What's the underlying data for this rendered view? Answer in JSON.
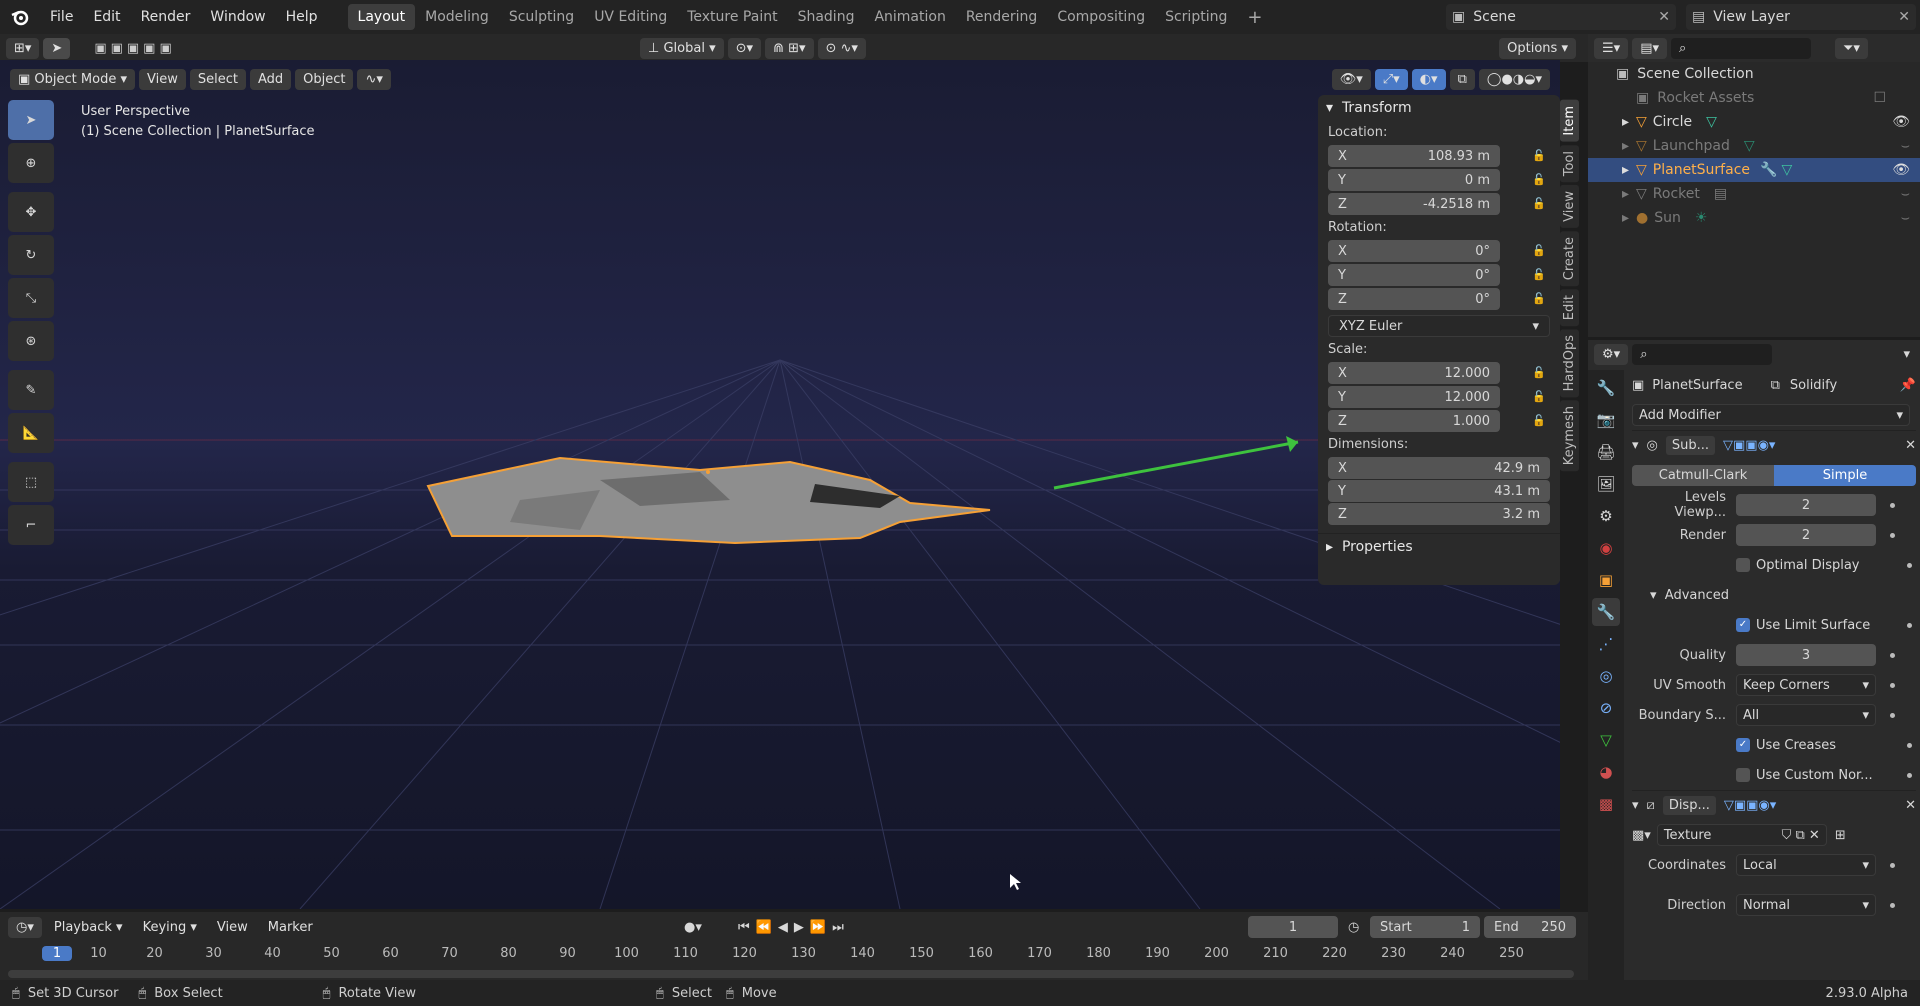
{
  "topbar": {
    "menus": [
      "File",
      "Edit",
      "Render",
      "Window",
      "Help"
    ],
    "workspaces": [
      "Layout",
      "Modeling",
      "Sculpting",
      "UV Editing",
      "Texture Paint",
      "Shading",
      "Animation",
      "Rendering",
      "Compositing",
      "Scripting"
    ],
    "scene": "Scene",
    "view_layer": "View Layer"
  },
  "toolhdr": {
    "orientation": "Global",
    "options": "Options"
  },
  "vphdr": {
    "mode": "Object Mode",
    "menus": [
      "View",
      "Select",
      "Add",
      "Object"
    ]
  },
  "viewport": {
    "perspective": "User Perspective",
    "collection": "(1) Scene Collection | PlanetSurface"
  },
  "npanel": {
    "title": "Transform",
    "location_label": "Location:",
    "loc": [
      {
        "axis": "X",
        "value": "108.93 m"
      },
      {
        "axis": "Y",
        "value": "0 m"
      },
      {
        "axis": "Z",
        "value": "-4.2518 m"
      }
    ],
    "rotation_label": "Rotation:",
    "rot": [
      {
        "axis": "X",
        "value": "0°"
      },
      {
        "axis": "Y",
        "value": "0°"
      },
      {
        "axis": "Z",
        "value": "0°"
      }
    ],
    "rot_mode": "XYZ Euler",
    "scale_label": "Scale:",
    "scale": [
      {
        "axis": "X",
        "value": "12.000"
      },
      {
        "axis": "Y",
        "value": "12.000"
      },
      {
        "axis": "Z",
        "value": "1.000"
      }
    ],
    "dimensions_label": "Dimensions:",
    "dim": [
      {
        "axis": "X",
        "value": "42.9 m"
      },
      {
        "axis": "Y",
        "value": "43.1 m"
      },
      {
        "axis": "Z",
        "value": "3.2 m"
      }
    ],
    "properties": "Properties"
  },
  "sidetabs": [
    "Item",
    "Tool",
    "View",
    "Create",
    "Edit",
    "HardOps",
    "Keymesh"
  ],
  "outliner": {
    "root": "Scene Collection",
    "items": [
      {
        "name": "Rocket Assets",
        "dim": true
      },
      {
        "name": "Circle",
        "dim": false
      },
      {
        "name": "Launchpad",
        "dim": true
      },
      {
        "name": "PlanetSurface",
        "dim": false,
        "selected": true
      },
      {
        "name": "Rocket",
        "dim": true
      },
      {
        "name": "Sun",
        "dim": true
      }
    ]
  },
  "props": {
    "object": "PlanetSurface",
    "modifier_breadcrumb": "Solidify",
    "add_modifier": "Add Modifier",
    "mod1": {
      "name": "Sub...",
      "type_a": "Catmull-Clark",
      "type_b": "Simple",
      "levels_label": "Levels Viewp...",
      "levels": "2",
      "render_label": "Render",
      "render": "2",
      "optimal": "Optimal Display",
      "advanced": "Advanced",
      "limit": "Use Limit Surface",
      "quality_label": "Quality",
      "quality": "3",
      "uvsmooth_label": "UV Smooth",
      "uvsmooth": "Keep Corners",
      "boundary_label": "Boundary S...",
      "boundary": "All",
      "creases": "Use Creases",
      "custom": "Use Custom Nor..."
    },
    "mod2": {
      "name": "Disp...",
      "texture": "Texture",
      "coords_label": "Coordinates",
      "coords": "Local",
      "direction_label": "Direction",
      "direction": "Normal"
    }
  },
  "timeline": {
    "menus": [
      "Playback",
      "Keying",
      "View",
      "Marker"
    ],
    "current": "1",
    "start_label": "Start",
    "start": "1",
    "end_label": "End",
    "end": "250",
    "ticks": [
      "1",
      "10",
      "20",
      "30",
      "40",
      "50",
      "60",
      "70",
      "80",
      "90",
      "100",
      "110",
      "120",
      "130",
      "140",
      "150",
      "160",
      "170",
      "180",
      "190",
      "200",
      "210",
      "220",
      "230",
      "240",
      "250"
    ]
  },
  "status": {
    "items": [
      "Set 3D Cursor",
      "Box Select",
      "Rotate View",
      "Select",
      "Move"
    ],
    "version": "2.93.0 Alpha"
  },
  "colors": {
    "accent": "#4a7ac7",
    "selection": "#f5a036",
    "arrow": "#3ec23e"
  }
}
